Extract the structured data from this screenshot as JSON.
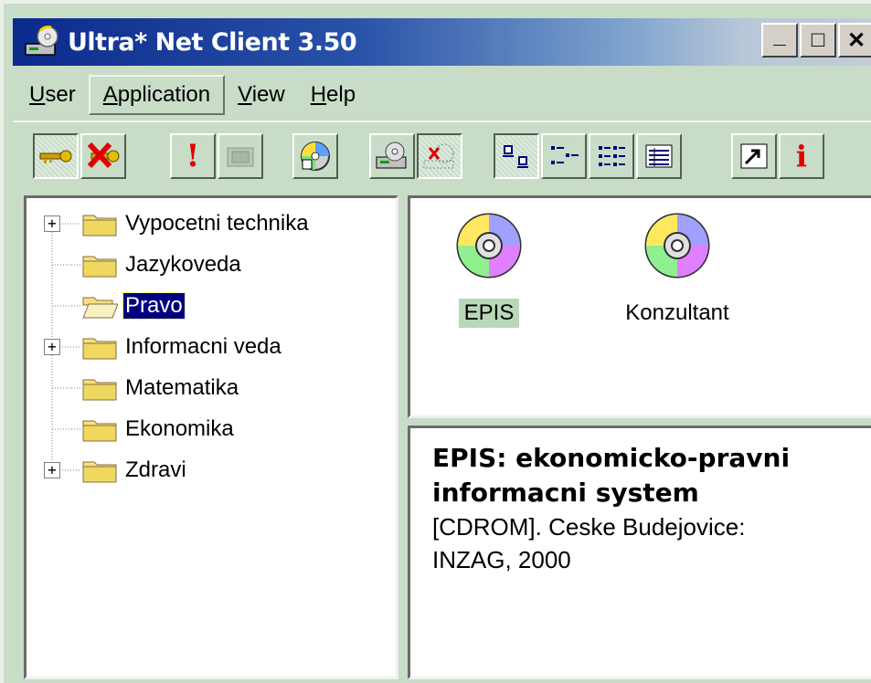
{
  "window": {
    "title": "Ultra* Net Client 3.50",
    "minimize_glyph": "_",
    "maximize_glyph": "□",
    "close_glyph": "✕"
  },
  "menu": [
    {
      "label": "User",
      "ul": "U",
      "rest": "ser"
    },
    {
      "label": "Application",
      "ul": "A",
      "rest": "pplication"
    },
    {
      "label": "View",
      "ul": "V",
      "rest": "iew"
    },
    {
      "label": "Help",
      "ul": "H",
      "rest": "elp"
    }
  ],
  "toolbar": {
    "info_glyph": "i",
    "alert_glyph": "!",
    "buttons": [
      "login-key-icon",
      "logout-key-icon",
      "alert-icon",
      "disabled-folder-icon",
      "cd-export-icon",
      "cd-drive-icon",
      "cd-disconnect-icon",
      "large-icons-view-icon",
      "small-icons-view-icon",
      "list-view-icon",
      "details-view-icon",
      "shortcut-icon",
      "info-icon"
    ]
  },
  "tree": [
    {
      "label": "Vypocetni technika",
      "expandable": true
    },
    {
      "label": "Jazykoveda",
      "expandable": false
    },
    {
      "label": "Pravo",
      "expandable": false,
      "selected": true,
      "open": true
    },
    {
      "label": "Informacni veda",
      "expandable": true
    },
    {
      "label": "Matematika",
      "expandable": false
    },
    {
      "label": "Ekonomika",
      "expandable": false
    },
    {
      "label": "Zdravi",
      "expandable": true
    }
  ],
  "expander_glyph": "+",
  "items": [
    {
      "label": "EPIS",
      "selected": true
    },
    {
      "label": "Konzultant",
      "selected": false
    }
  ],
  "detail": {
    "title_line1": "EPIS: ekonomicko-pravni",
    "title_line2": "informacni system",
    "body_line1": "[CDROM]. Ceske Budejovice:",
    "body_line2": "INZAG, 2000"
  },
  "colors": {
    "title_gradient_start": "#0a2a8c",
    "window_bg": "#c8dcc8",
    "selection": "#000080",
    "info_red": "#e00000"
  }
}
